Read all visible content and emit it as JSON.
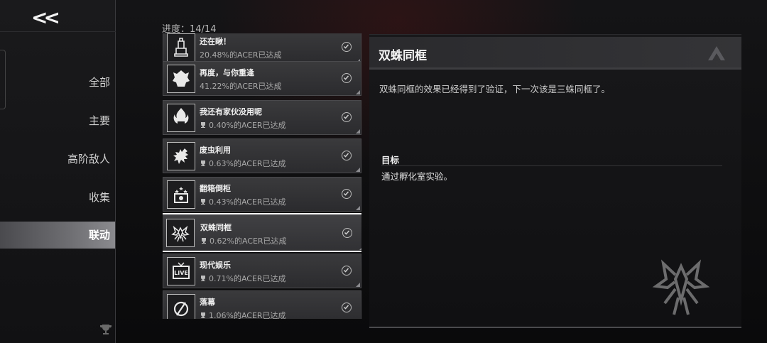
{
  "sidebar": {
    "back_label": "<<",
    "items": [
      {
        "label": "全部",
        "active": false
      },
      {
        "label": "主要",
        "active": false
      },
      {
        "label": "高阶敌人",
        "active": false
      },
      {
        "label": "收集",
        "active": false
      },
      {
        "label": "联动",
        "active": true
      }
    ]
  },
  "progress": {
    "text": "进度：14/14",
    "completed": 14,
    "total": 14
  },
  "achievements": [
    {
      "title": "还在瞅！",
      "rate": "20.48%的ACER已达成",
      "rare": false,
      "icon": "monument-icon"
    },
    {
      "title": "再度，与你重逢",
      "rate": "41.22%的ACER已达成",
      "rare": false,
      "icon": "beast-icon"
    },
    {
      "title": "我还有家伙没用呢",
      "rate": "0.40%的ACER已达成",
      "rare": true,
      "icon": "fire-head-icon"
    },
    {
      "title": "废虫利用",
      "rate": "0.63%的ACER已达成",
      "rare": true,
      "icon": "bug-icon"
    },
    {
      "title": "翻箱倒柜",
      "rate": "0.43%的ACER已达成",
      "rare": true,
      "icon": "chest-icon"
    },
    {
      "title": "双蛛同框",
      "rate": "0.62%的ACER已达成",
      "rare": true,
      "icon": "spider-icon",
      "selected": true
    },
    {
      "title": "现代娱乐",
      "rate": "0.71%的ACER已达成",
      "rare": true,
      "icon": "live-tv-icon"
    },
    {
      "title": "落幕",
      "rate": "1.06%的ACER已达成",
      "rare": true,
      "icon": "no-sign-icon"
    }
  ],
  "detail": {
    "title": "双蛛同框",
    "description": "双蛛同框的效果已经得到了验证，下一次该是三蛛同框了。",
    "goal_label": "目标",
    "goal_text": "通过孵化室实验。"
  },
  "colors": {
    "selected_border": "#ffffff",
    "tile_bg": "#333336",
    "accent_gray": "#8a8a8e"
  }
}
